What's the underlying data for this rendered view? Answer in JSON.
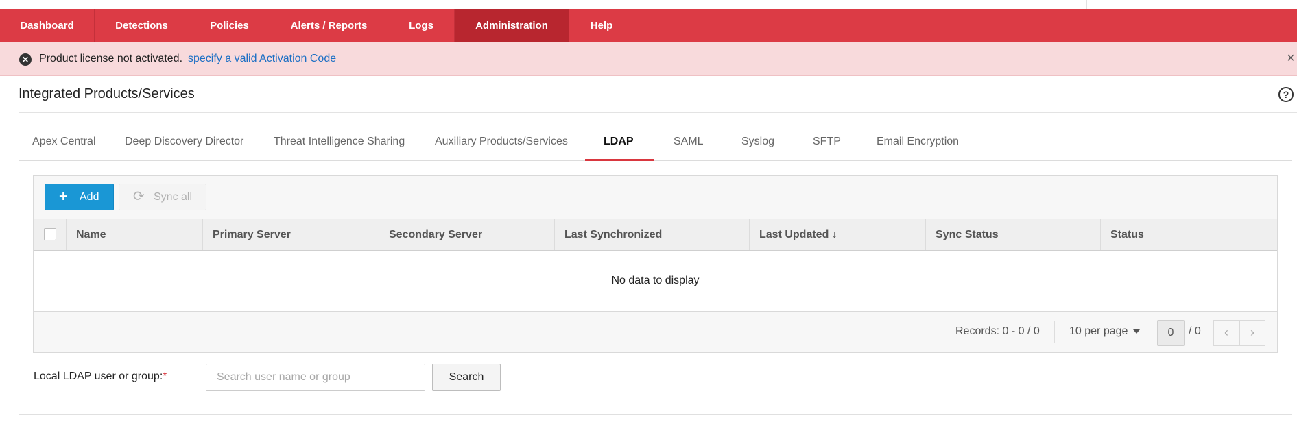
{
  "nav": {
    "items": [
      {
        "label": "Dashboard"
      },
      {
        "label": "Detections"
      },
      {
        "label": "Policies"
      },
      {
        "label": "Alerts / Reports"
      },
      {
        "label": "Logs"
      },
      {
        "label": "Administration",
        "active": true
      },
      {
        "label": "Help"
      }
    ]
  },
  "alert": {
    "message": "Product license not activated.",
    "link": "specify a valid Activation Code",
    "close": "×"
  },
  "page": {
    "title": "Integrated Products/Services",
    "help": "?"
  },
  "tabs": [
    {
      "label": "Apex Central"
    },
    {
      "label": "Deep Discovery Director"
    },
    {
      "label": "Threat Intelligence Sharing"
    },
    {
      "label": "Auxiliary Products/Services"
    },
    {
      "label": "LDAP",
      "active": true
    },
    {
      "label": "SAML"
    },
    {
      "label": "Syslog"
    },
    {
      "label": "SFTP"
    },
    {
      "label": "Email Encryption"
    }
  ],
  "toolbar": {
    "add_label": "Add",
    "add_icon": "plus-icon",
    "sync_label": "Sync all",
    "sync_icon": "refresh-icon"
  },
  "table": {
    "columns": [
      "Name",
      "Primary Server",
      "Secondary Server",
      "Last Synchronized",
      "Last Updated ↓",
      "Sync Status",
      "Status"
    ],
    "sorted_column": "Last Updated",
    "empty_message": "No data to display"
  },
  "footer": {
    "records": "Records: 0 - 0 / 0",
    "per_page": "10 per page",
    "page_value": "0",
    "page_total": "/ 0",
    "prev": "‹",
    "next": "›"
  },
  "ldap_search": {
    "label": "Local LDAP user or group:",
    "required_mark": "*",
    "placeholder": "Search user name or group",
    "value": "",
    "button_label": "Search"
  },
  "colors": {
    "nav_bg": "#dc3b45",
    "nav_active": "#b8262f",
    "alert_bg": "#f8dadc",
    "link": "#1b6fc4",
    "primary_button": "#1a97d5",
    "tab_underline": "#d9373f"
  }
}
